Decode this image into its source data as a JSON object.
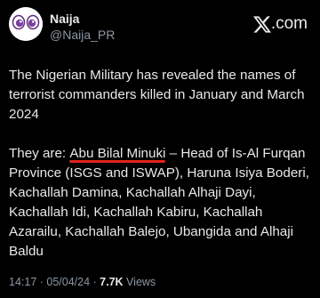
{
  "author": {
    "name": "Naija",
    "handle": "@Naija_PR"
  },
  "brand": {
    "logo_icon": "x-logo-icon",
    "text": ".com"
  },
  "tweet": {
    "paragraph1": "The Nigerian Military has revealed the names of terrorist commanders killed in January and March 2024",
    "paragraph2_prefix": "They are: ",
    "highlighted_name": "Abu Bilal Minuki",
    "paragraph2_rest": " – Head of Is-Al Furqan Province (ISGS and ISWAP),  Haruna Isiya Boderi, Kachallah Damina, Kachallah Alhaji Dayi, Kachallah Idi, Kachallah Kabiru, Kachallah Azarailu, Kachallah Balejo, Ubangida and Alhaji Baldu"
  },
  "meta": {
    "time": "14:17",
    "separator1": " · ",
    "date": "05/04/24",
    "separator2": " · ",
    "views_count": "7.7K",
    "views_label": " Views"
  },
  "colors": {
    "background": "#000000",
    "text": "#e7e9ea",
    "muted": "#8b98a5",
    "underline": "#e0231b",
    "avatar_eyes": "#7b3fa0"
  }
}
